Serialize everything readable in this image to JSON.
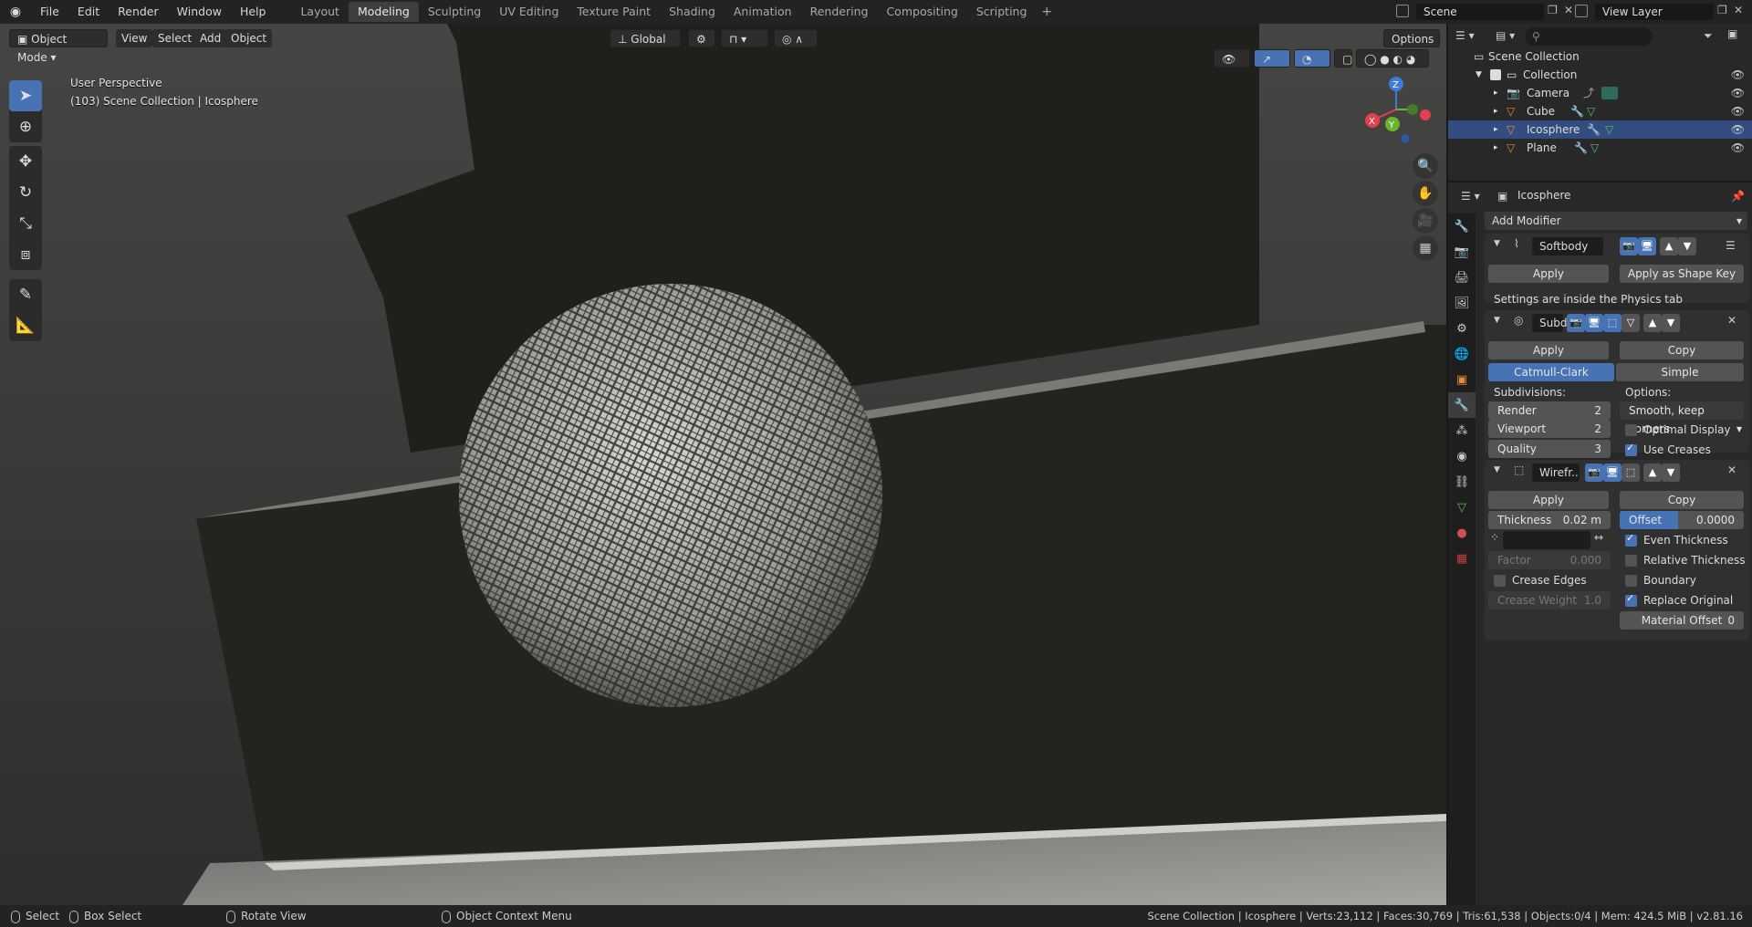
{
  "topbar": {
    "menus": [
      "File",
      "Edit",
      "Render",
      "Window",
      "Help"
    ],
    "workspaces": [
      "Layout",
      "Modeling",
      "Sculpting",
      "UV Editing",
      "Texture Paint",
      "Shading",
      "Animation",
      "Rendering",
      "Compositing",
      "Scripting"
    ],
    "active_workspace": "Modeling",
    "add_tab": "+",
    "scene": "Scene",
    "view_layer": "View Layer"
  },
  "viewport_header": {
    "mode": "Object Mode",
    "menus": [
      "View",
      "Select",
      "Add",
      "Object"
    ],
    "orientation": "Global",
    "options": "Options"
  },
  "viewport": {
    "perspective": "User Perspective",
    "context": "(103) Scene Collection | Icosphere",
    "gizmo_axes": {
      "x": "X",
      "y": "Y",
      "z": "Z"
    }
  },
  "outliner": {
    "root": "Scene Collection",
    "collection": "Collection",
    "objects": [
      "Camera",
      "Cube",
      "Icosphere",
      "Plane"
    ],
    "selected": "Icosphere"
  },
  "properties": {
    "object_name": "Icosphere",
    "add_modifier": "Add Modifier",
    "softbody": {
      "name": "Softbody",
      "apply": "Apply",
      "apply_shape": "Apply as Shape Key",
      "note": "Settings are inside the Physics tab"
    },
    "subsurf": {
      "name": "Subd",
      "apply": "Apply",
      "copy": "Copy",
      "type_a": "Catmull-Clark",
      "type_b": "Simple",
      "subdivisions_label": "Subdivisions:",
      "options_label": "Options:",
      "render_label": "Render",
      "render_value": "2",
      "viewport_label": "Viewport",
      "viewport_value": "2",
      "quality_label": "Quality",
      "quality_value": "3",
      "uv_smooth": "Smooth, keep corners",
      "optimal_display": "Optimal Display",
      "use_creases": "Use Creases"
    },
    "wireframe": {
      "name": "Wirefr..",
      "apply": "Apply",
      "copy": "Copy",
      "thickness_label": "Thickness",
      "thickness_value": "0.02 m",
      "offset_label": "Offset",
      "offset_value": "0.0000",
      "factor_label": "Factor",
      "factor_value": "0.000",
      "crease_edges": "Crease Edges",
      "crease_weight_label": "Crease Weight",
      "crease_weight_value": "1.0",
      "even_thickness": "Even Thickness",
      "relative_thickness": "Relative Thickness",
      "boundary": "Boundary",
      "replace_original": "Replace Original",
      "material_offset_label": "Material Offset",
      "material_offset_value": "0"
    }
  },
  "statusbar": {
    "select": "Select",
    "box_select": "Box Select",
    "rotate_view": "Rotate View",
    "context_menu": "Object Context Menu",
    "stats": "Scene Collection | Icosphere | Verts:23,112 | Faces:30,769 | Tris:61,538 | Objects:0/4 | Mem: 424.5 MiB | v2.81.16"
  },
  "colors": {
    "accent": "#4772b3",
    "panel": "#282828",
    "header": "#232323"
  }
}
